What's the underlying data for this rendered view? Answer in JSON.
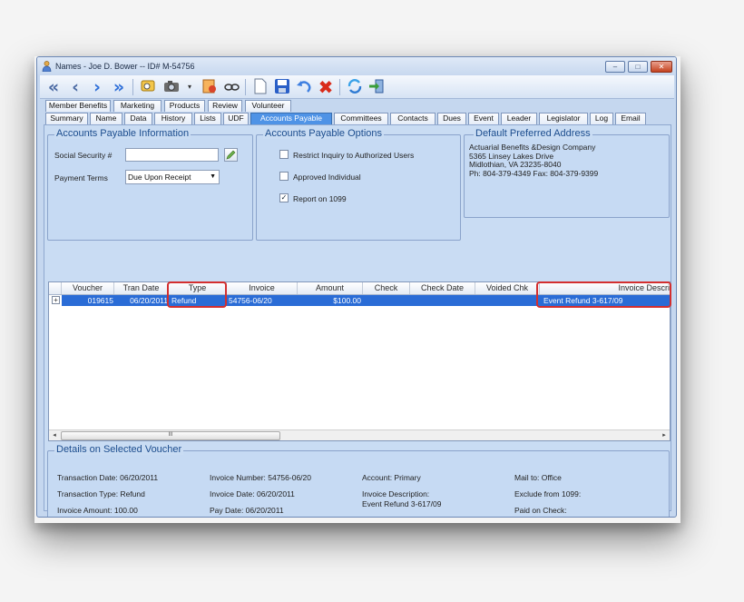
{
  "window": {
    "title": "Names - Joe D. Bower  -- ID# M-54756",
    "buttons": {
      "minimize": "–",
      "maximize": "□",
      "close": "✕"
    }
  },
  "toolbar": {
    "icons": [
      "first-record-icon",
      "previous-record-icon",
      "next-record-icon",
      "last-record-icon",
      "search-icon",
      "camera-icon",
      "dropdown-icon",
      "report-icon",
      "view-icon",
      "new-document-icon",
      "save-icon",
      "undo-icon",
      "delete-icon",
      "refresh-icon",
      "exit-icon"
    ]
  },
  "tabs": {
    "row1": [
      "Member Benefits",
      "Marketing",
      "Products",
      "Review",
      "Volunteer"
    ],
    "row2": [
      "Summary",
      "Name",
      "Data",
      "History",
      "Lists",
      "UDF",
      "Accounts Payable",
      "Committees",
      "Contacts",
      "Dues",
      "Event",
      "Leader",
      "Legislator",
      "Log",
      "Email"
    ],
    "active": "Accounts Payable"
  },
  "ap_info": {
    "legend": "Accounts Payable Information",
    "ssn_label": "Social Security #",
    "ssn_value": "",
    "payment_terms_label": "Payment Terms",
    "payment_terms_value": "Due Upon Receipt"
  },
  "ap_options": {
    "legend": "Accounts Payable Options",
    "restrict_label": "Restrict Inquiry to Authorized Users",
    "restrict_checked": false,
    "approved_label": "Approved Individual",
    "approved_checked": false,
    "report_label": "Report on 1099",
    "report_checked": true
  },
  "address": {
    "legend": "Default Preferred Address",
    "line1": "Actuarial Benefits &Design Company",
    "line2": "5365 Linsey Lakes Drive",
    "line3": "Midlothian, VA  23235-8040",
    "line4": "Ph: 804-379-4349   Fax: 804-379-9399"
  },
  "grid": {
    "columns": [
      "Voucher",
      "Tran Date",
      "Type",
      "Invoice",
      "Amount",
      "Check",
      "Check Date",
      "Voided Chk",
      "Invoice Descri"
    ],
    "rows": [
      {
        "voucher": "019615",
        "tran_date": "06/20/2011",
        "type": "Refund",
        "invoice": "54756-06/20",
        "amount": "$100.00",
        "check": "",
        "check_date": "",
        "voided_chk": "",
        "invoice_description": "Event Refund 3-617/09"
      }
    ],
    "expand_glyph": "+",
    "scroll_left": "◂",
    "scroll_right": "▸",
    "thumb_grip": "III"
  },
  "details": {
    "legend": "Details on Selected Voucher",
    "transaction_date": "Transaction Date:  06/20/2011",
    "transaction_type": "Transaction Type:  Refund",
    "invoice_amount": "Invoice Amount:  100.00",
    "invoice_number": "Invoice Number:  54756-06/20",
    "invoice_date": "Invoice Date:  06/20/2011",
    "pay_date": "Pay Date:  06/20/2011",
    "account": "Account:  Primary",
    "invoice_description_label": "Invoice Description:",
    "invoice_description_value": "Event Refund 3-617/09",
    "mail_to": "Mail to:  Office",
    "exclude_1099": "Exclude from 1099:",
    "paid_on_check": "Paid on Check:"
  },
  "colors": {
    "selection": "#2a6cd6",
    "highlight_box": "#d32f2f",
    "legend_text": "#1c4d8e",
    "panel_bg": "#c6daf3"
  }
}
